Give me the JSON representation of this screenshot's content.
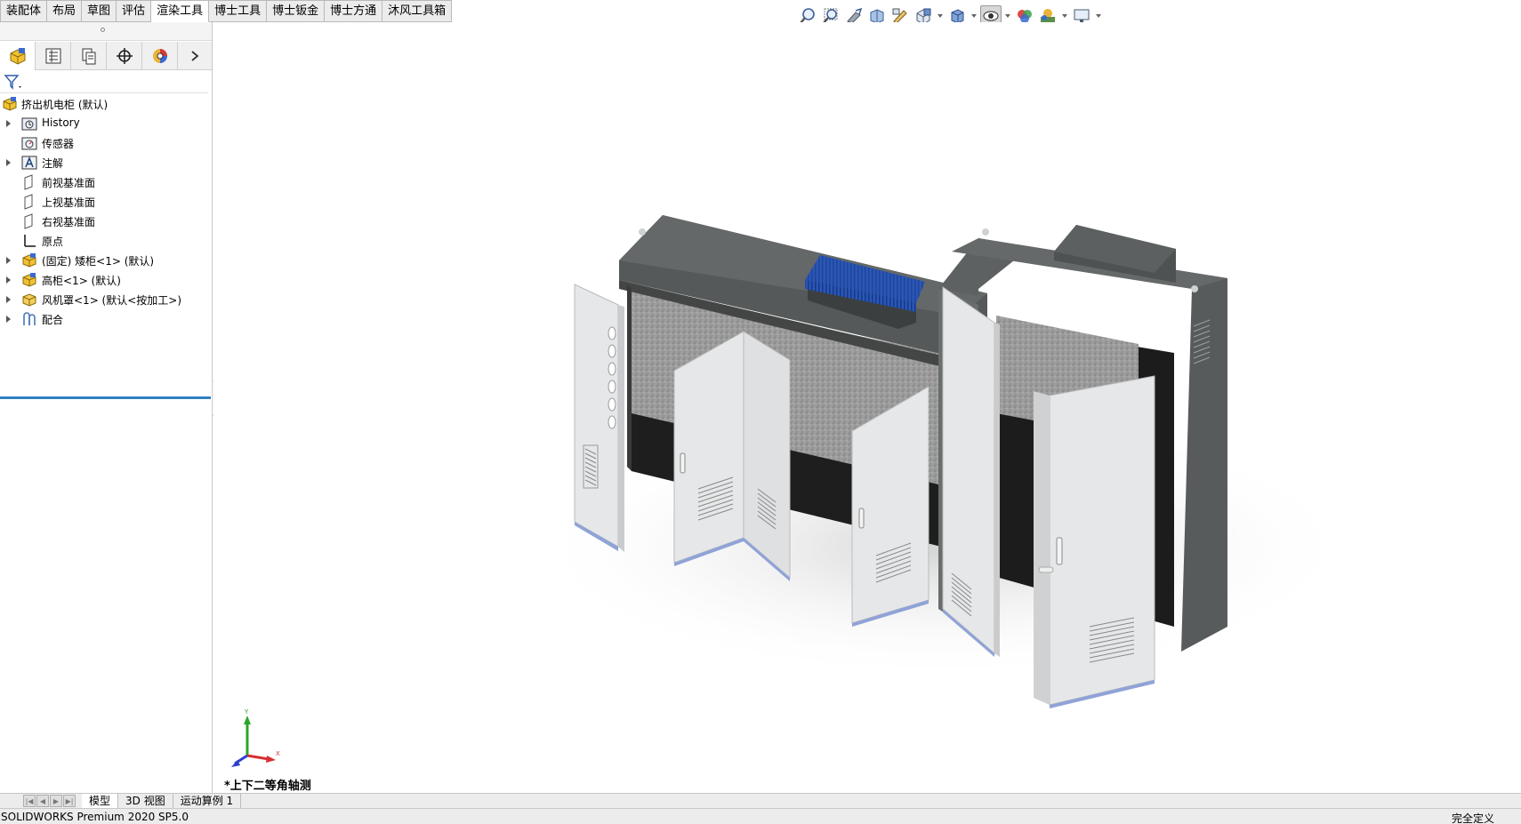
{
  "command_tabs": [
    "装配体",
    "布局",
    "草图",
    "评估",
    "渲染工具",
    "博士工具",
    "博士钣金",
    "博士方通",
    "沐风工具箱"
  ],
  "active_command_tab": "渲染工具",
  "hud_icons": [
    "zoom-to-fit-icon",
    "zoom-to-area-icon",
    "previous-view-icon",
    "section-view-icon",
    "dynamic-annotation-icon",
    "view-orientation-icon",
    "display-style-icon",
    "hide-show-items-icon",
    "edit-appearance-icon",
    "apply-scene-icon",
    "view-settings-icon"
  ],
  "panel_tabs": [
    "featuremanager-tab",
    "propertymanager-tab",
    "configurationmanager-tab",
    "dimxpertmanager-tab",
    "displaymanager-tab"
  ],
  "tree": {
    "root": "挤出机电柜  (默认)",
    "items": [
      {
        "label": "History",
        "icon": "history-folder-icon",
        "expandable": true
      },
      {
        "label": "传感器",
        "icon": "sensor-icon",
        "expandable": false
      },
      {
        "label": "注解",
        "icon": "annotation-icon",
        "expandable": true
      },
      {
        "label": "前视基准面",
        "icon": "plane-icon",
        "expandable": false
      },
      {
        "label": "上视基准面",
        "icon": "plane-icon",
        "expandable": false
      },
      {
        "label": "右视基准面",
        "icon": "plane-icon",
        "expandable": false
      },
      {
        "label": "原点",
        "icon": "origin-icon",
        "expandable": false
      },
      {
        "label": "(固定) 矮柜<1> (默认)",
        "icon": "part-icon",
        "expandable": true
      },
      {
        "label": "高柜<1> (默认)",
        "icon": "part-icon",
        "expandable": true
      },
      {
        "label": "风机罩<1> (默认<按加工>)",
        "icon": "part-icon",
        "expandable": true
      },
      {
        "label": "配合",
        "icon": "mates-icon",
        "expandable": true
      }
    ]
  },
  "viewport": {
    "view_name": "*上下二等角轴测",
    "triad": {
      "x": "X",
      "y": "Y"
    }
  },
  "bottom_tabs": [
    "模型",
    "3D 视图",
    "运动算例 1"
  ],
  "active_bottom_tab": "模型",
  "status": {
    "left": "SOLIDWORKS Premium 2020 SP5.0",
    "right": "完全定义"
  },
  "colors": {
    "cabinet_body": "#585a5a",
    "door_panel": "#e6e7e8",
    "interior": "#2a2a2a",
    "fan_cover": "#1f4aa8",
    "rollback_bar": "#2f80c2"
  }
}
